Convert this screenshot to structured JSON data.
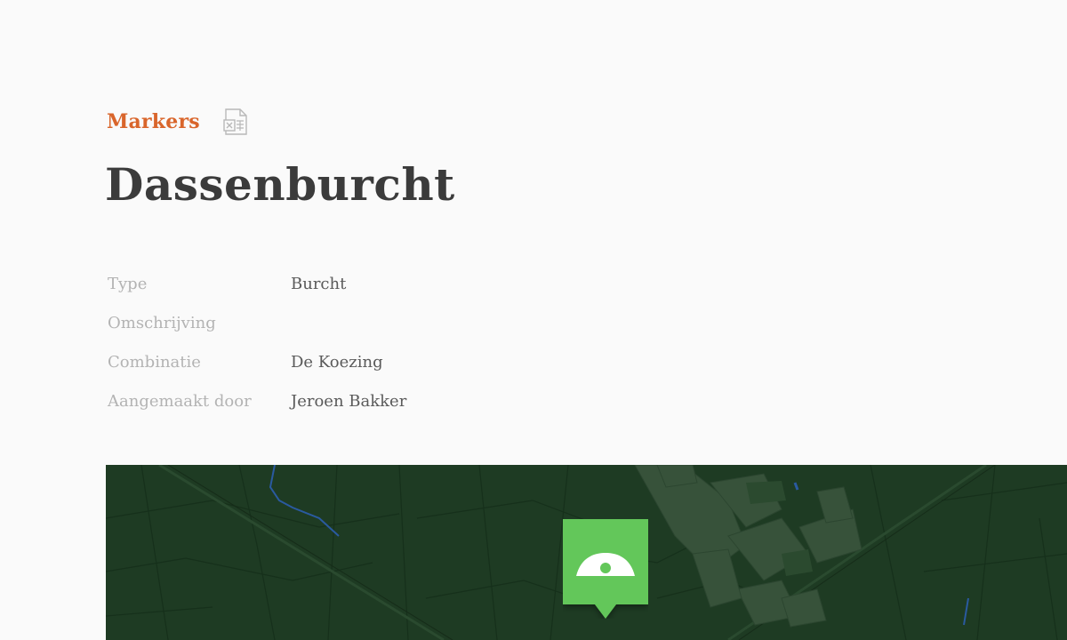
{
  "breadcrumb": {
    "link_label": "Markers",
    "export_icon": "excel-export-icon"
  },
  "title": "Dassenburcht",
  "details": {
    "type": {
      "label": "Type",
      "value": "Burcht"
    },
    "description": {
      "label": "Omschrijving",
      "value": ""
    },
    "combination": {
      "label": "Combinatie",
      "value": "De Koezing"
    },
    "created_by": {
      "label": "Aangemaakt door",
      "value": "Jeroen Bakker"
    }
  },
  "map": {
    "marker_icon": "badger-burrow-icon",
    "colors": {
      "background": "#1e3b23",
      "marker": "#63c75a",
      "accent": "#d9652b"
    }
  }
}
